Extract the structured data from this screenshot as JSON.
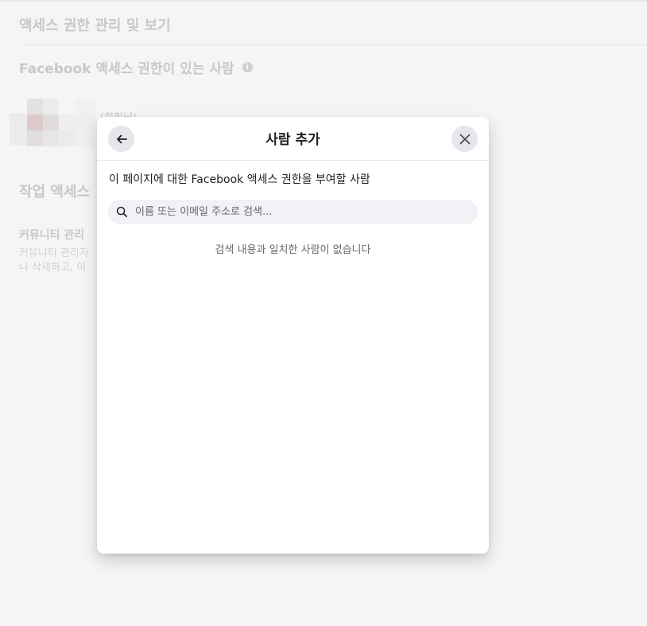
{
  "background": {
    "title": "액세스 권한 관리 및 보기",
    "section_title": "Facebook 액세스 권한이 있는 사람",
    "info_icon": "i",
    "avatar_note": "(회원님)",
    "task_section_title": "작업 액세스",
    "community_manager": {
      "title": "커뮤니티 관리",
      "line1": "커뮤니티 관리자",
      "line2": "나 삭제하고, 이"
    }
  },
  "dialog": {
    "title": "사람 추가",
    "back_icon": "arrow-left-icon",
    "close_icon": "close-icon",
    "subtitle": "이 페이지에 대한 Facebook 액세스 권한을 부여할 사람",
    "search": {
      "placeholder": "이름 또는 이메일 주소로 검색...",
      "value": "",
      "icon": "search-icon"
    },
    "empty_message": "검색 내용과 일치한 사람이 없습니다"
  },
  "colors": {
    "page_bg": "#f5f5f5",
    "dialog_bg": "#ffffff",
    "button_bg": "#e4e6eb",
    "search_bg": "#f0f2f5",
    "text_primary": "#1c1e21",
    "text_secondary": "#65676b"
  }
}
